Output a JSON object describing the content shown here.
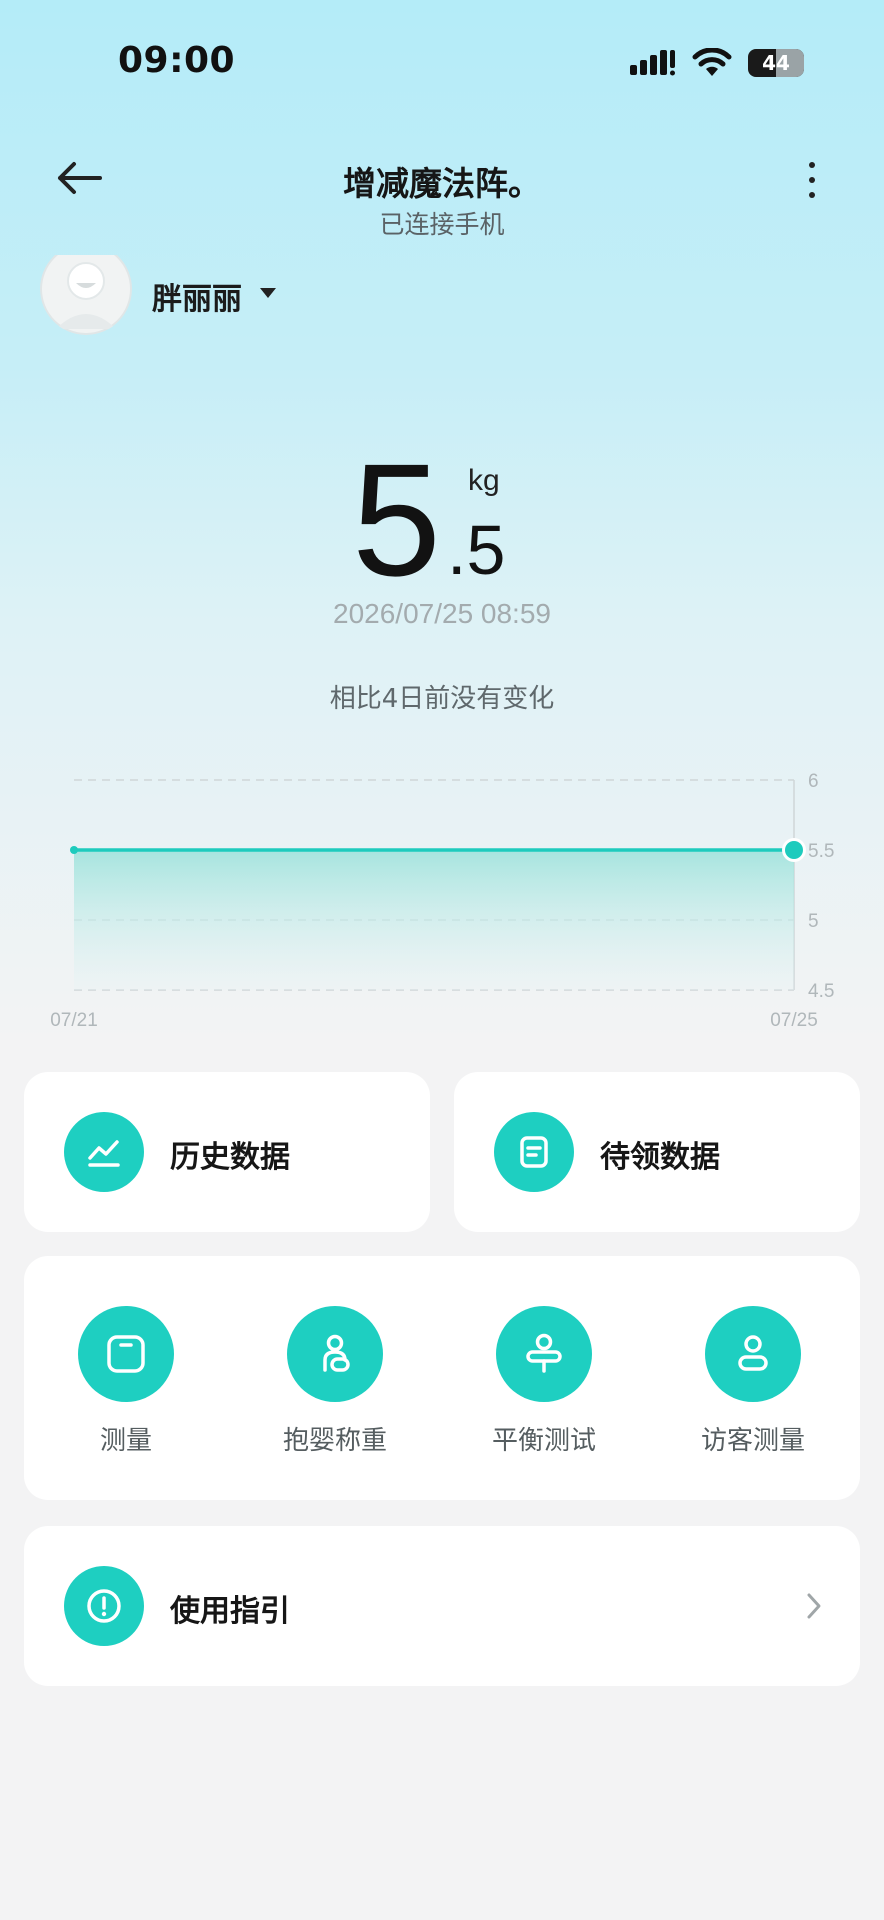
{
  "status_bar": {
    "time": "09:00",
    "battery": "44"
  },
  "header": {
    "title": "增减魔法阵。",
    "subtitle": "已连接手机"
  },
  "user": {
    "name": "胖丽丽"
  },
  "weight": {
    "integer": "5",
    "decimal": ".5",
    "unit": "kg",
    "time": "2026/07/25 08:59",
    "comparison": "相比4日前没有变化"
  },
  "chart_data": {
    "type": "area",
    "x": [
      "07/21",
      "07/25"
    ],
    "series": [
      {
        "values": [
          5.5,
          5.5
        ]
      }
    ],
    "xlabels": [
      "07/21",
      "07/25"
    ],
    "yticks": [
      "6",
      "5.5",
      "5",
      "4.5"
    ],
    "ylim": [
      4.5,
      6
    ],
    "grid": true,
    "colors": {
      "line": "#1ecbbd"
    }
  },
  "cards": {
    "history_label": "历史数据",
    "pending_label": "待领数据"
  },
  "actions": [
    {
      "label": "测量",
      "icon": "scale-icon"
    },
    {
      "label": "抱婴称重",
      "icon": "baby-weigh-icon"
    },
    {
      "label": "平衡测试",
      "icon": "balance-icon"
    },
    {
      "label": "访客测量",
      "icon": "guest-icon"
    }
  ],
  "guide": {
    "label": "使用指引"
  },
  "colors": {
    "accent": "#1ecfc1"
  }
}
